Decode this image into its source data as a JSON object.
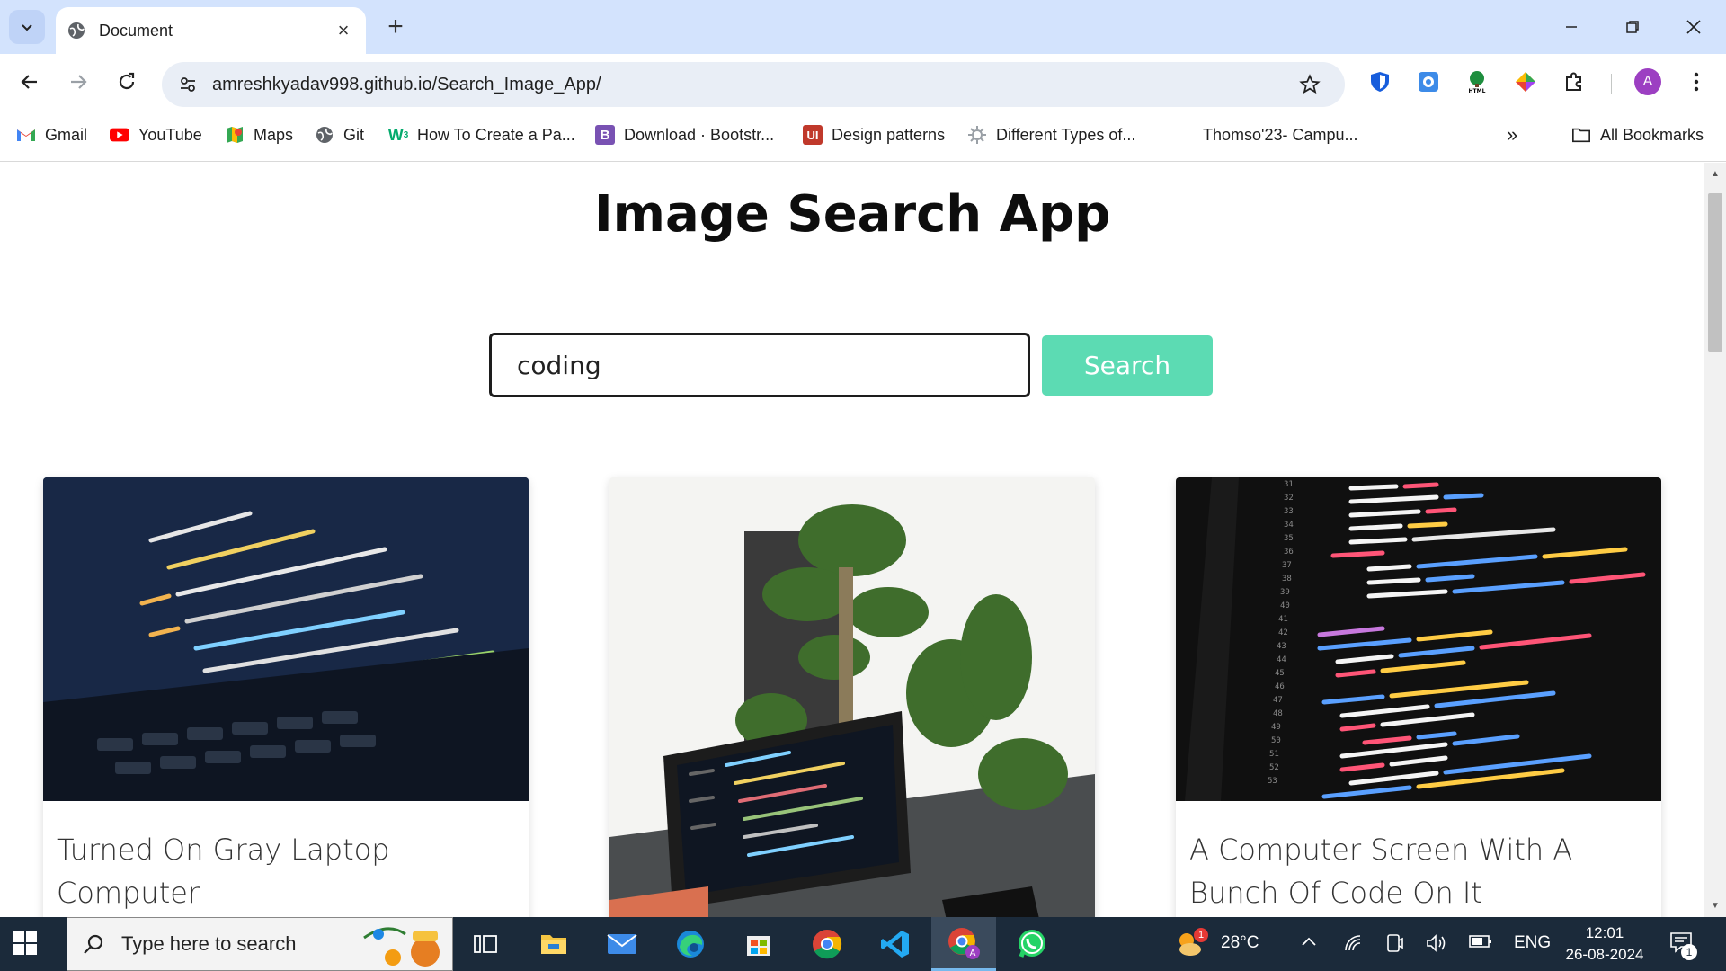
{
  "browser": {
    "tab_title": "Document",
    "url": "amreshkyadav998.github.io/Search_Image_App/",
    "avatar_letter": "A",
    "bookmarks": [
      {
        "label": "Gmail",
        "icon": "gmail-icon"
      },
      {
        "label": "YouTube",
        "icon": "youtube-icon"
      },
      {
        "label": "Maps",
        "icon": "maps-icon"
      },
      {
        "label": "Git",
        "icon": "globe-icon"
      },
      {
        "label": "How To Create a Pa...",
        "icon": "w3-icon"
      },
      {
        "label": "Download · Bootstr...",
        "icon": "bootstrap-icon"
      },
      {
        "label": "Design patterns",
        "icon": "ui-icon"
      },
      {
        "label": "Different Types of...",
        "icon": "gear-icon"
      },
      {
        "label": "Thomso'23- Campu...",
        "icon": ""
      }
    ],
    "all_bookmarks_label": "All Bookmarks"
  },
  "page": {
    "title": "Image Search App",
    "search_value": "coding",
    "search_button": "Search",
    "results": [
      {
        "caption": "Turned On Gray Laptop Computer"
      },
      {
        "caption": ""
      },
      {
        "caption": "A Computer Screen With A Bunch Of Code On It"
      }
    ]
  },
  "taskbar": {
    "search_placeholder": "Type here to search",
    "temperature": "28°C",
    "weather_badge": "1",
    "language": "ENG",
    "time": "12:01",
    "date": "26-08-2024",
    "notification_count": "1"
  },
  "colors": {
    "tabstrip": "#d3e3fd",
    "search_button": "#5cdbb3",
    "taskbar": "#1b2a3a"
  }
}
